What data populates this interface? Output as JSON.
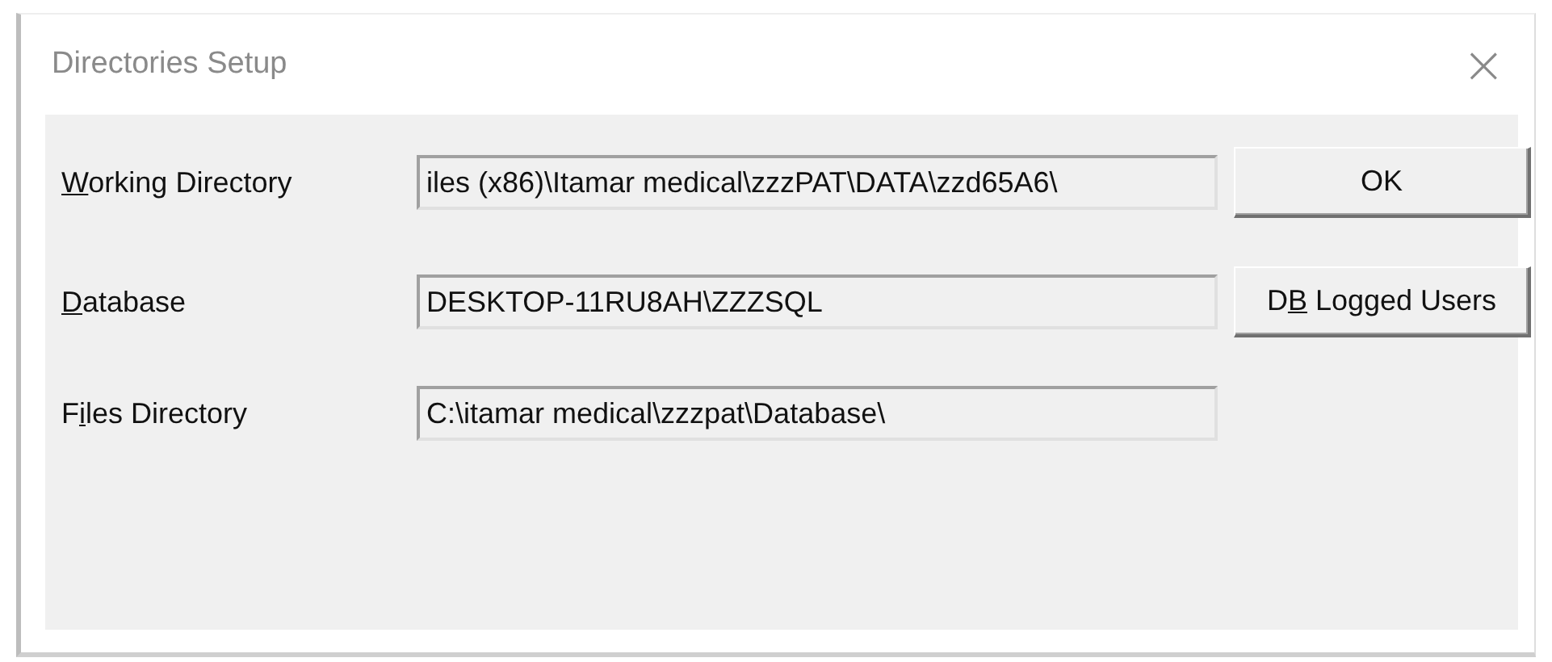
{
  "window": {
    "title": "Directories Setup",
    "close": "×"
  },
  "fields": [
    {
      "label": {
        "access_key": "W",
        "after": "orking Directory"
      },
      "value": "iles (x86)\\Itamar medical\\zzzPAT\\DATA\\zzd65A6\\",
      "button": {
        "after": "OK"
      }
    },
    {
      "label": {
        "access_key": "D",
        "after": "atabase"
      },
      "value": "DESKTOP-11RU8AH\\ZZZSQL",
      "button": {
        "before": "D",
        "access_key": "B",
        "after": " Logged Users"
      }
    },
    {
      "label": {
        "before": "F",
        "access_key": "i",
        "after": "les Directory"
      },
      "value": "C:\\itamar medical\\zzzpat\\Database\\"
    }
  ]
}
